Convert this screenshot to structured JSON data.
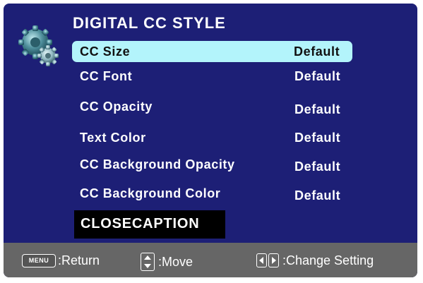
{
  "menu": {
    "title": "DIGITAL CC STYLE",
    "icon": "closed-caption-settings-icon",
    "selected_index": 0,
    "items": [
      {
        "label": "CC Size",
        "value": "Default"
      },
      {
        "label": "CC Font",
        "value": "Default"
      },
      {
        "label": "CC Opacity",
        "value": "Default"
      },
      {
        "label": "Text Color",
        "value": "Default"
      },
      {
        "label": "CC Background Opacity",
        "value": "Default"
      },
      {
        "label": "CC Background Color",
        "value": "Default"
      }
    ],
    "preview_text": "CLOSECAPTION"
  },
  "footer": {
    "return": {
      "key": "MENU",
      "label": ":Return"
    },
    "move": {
      "label": ":Move"
    },
    "change": {
      "label": ":Change Setting"
    }
  },
  "colors": {
    "background": "#1d1f76",
    "highlight": "#b3f4fb",
    "footer": "#666666"
  }
}
